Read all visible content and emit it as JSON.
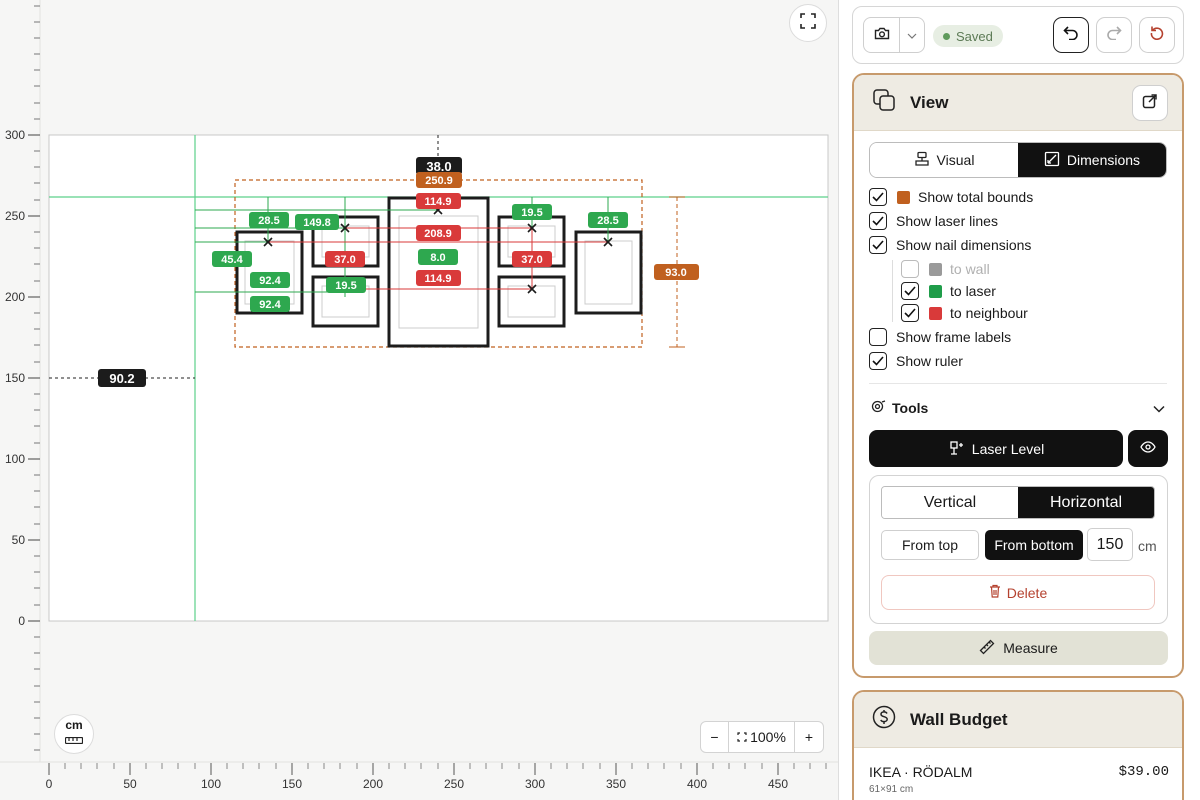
{
  "canvas": {
    "y_ruler_labels": [
      "300",
      "250",
      "200",
      "150",
      "100",
      "50",
      "0"
    ],
    "x_ruler_labels": [
      "0",
      "50",
      "100",
      "150",
      "200",
      "250",
      "300",
      "350",
      "400",
      "450"
    ],
    "unit_button_label": "cm",
    "zoom": {
      "minus": "−",
      "value": "100%",
      "plus": "+"
    },
    "fullscreen_icon": "expand-icon",
    "tags": {
      "top_center": "38.0",
      "bounds_width": "250.9",
      "left_distance": "90.2",
      "right_height": "93.0",
      "laser_a_1": "28.5",
      "laser_a_2": "149.8",
      "laser_a_3": "19.5",
      "laser_a_4": "28.5",
      "laser_left_1": "45.4",
      "laser_v_1": "92.4",
      "laser_v_2": "92.4",
      "laser_v_3": "19.5",
      "laser_v_4": "8.0",
      "neighbour_1": "114.9",
      "neighbour_2": "208.9",
      "neighbour_3": "37.0",
      "neighbour_4": "37.0",
      "neighbour_5": "114.9"
    },
    "colors": {
      "laser": "#2ea84f",
      "neighbour": "#d93a3a",
      "bounds": "#c0601f",
      "dark": "#1c1c1c"
    }
  },
  "toolbar": {
    "status": "Saved",
    "camera_icon": "camera-icon",
    "undo_icon": "undo-icon",
    "redo_icon": "redo-icon",
    "reset_icon": "reset-icon"
  },
  "view_panel": {
    "title": "View",
    "share_icon": "share-icon",
    "tabs": [
      {
        "label": "Visual",
        "active": false
      },
      {
        "label": "Dimensions",
        "active": true
      }
    ],
    "options": [
      {
        "label": "Show total bounds",
        "checked": true,
        "swatch": "#c0601f"
      },
      {
        "label": "Show laser lines",
        "checked": true
      },
      {
        "label": "Show nail dimensions",
        "checked": true
      },
      {
        "label": "to wall",
        "checked": false,
        "swatch": "#9a9a9a"
      },
      {
        "label": "to laser",
        "checked": true,
        "swatch": "#1f9d4a"
      },
      {
        "label": "to neighbour",
        "checked": true,
        "swatch": "#d93a3a"
      },
      {
        "label": "Show frame labels",
        "checked": false
      },
      {
        "label": "Show ruler",
        "checked": true
      }
    ],
    "tools": {
      "title": "Tools",
      "laser_level": "Laser Level",
      "orientation": [
        "Vertical",
        "Horizontal"
      ],
      "orientation_active": "Horizontal",
      "from_top": "From top",
      "from_bottom": "From bottom",
      "from_active": "From bottom",
      "distance_value": "150",
      "distance_unit": "cm",
      "delete": "Delete",
      "measure": "Measure"
    }
  },
  "budget_panel": {
    "title": "Wall Budget",
    "items": [
      {
        "name": "IKEA · RÖDALM",
        "price": "$39.00",
        "size": "61×91 cm"
      }
    ]
  }
}
